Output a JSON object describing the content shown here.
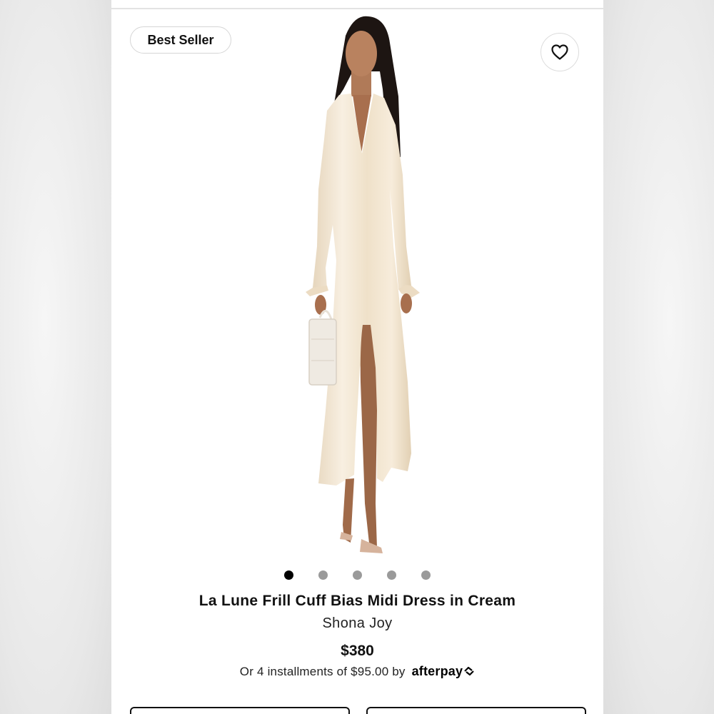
{
  "badge": {
    "label": "Best Seller"
  },
  "product": {
    "title": "La Lune Frill Cuff Bias Midi Dress in Cream",
    "brand": "Shona Joy",
    "price": "$380",
    "installments_text": "Or 4 installments of $95.00 by",
    "afterpay_label": "afterpay"
  },
  "carousel": {
    "total_images": 5,
    "active_index": 0
  },
  "colors": {
    "dress": "#f2e6d2",
    "skin": "#b07a58",
    "hair": "#1d1512",
    "active_dot": "#000000",
    "inactive_dot": "#9a9a9a"
  },
  "icons": {
    "wishlist": "heart-icon",
    "afterpay": "afterpay-arrows-icon"
  }
}
